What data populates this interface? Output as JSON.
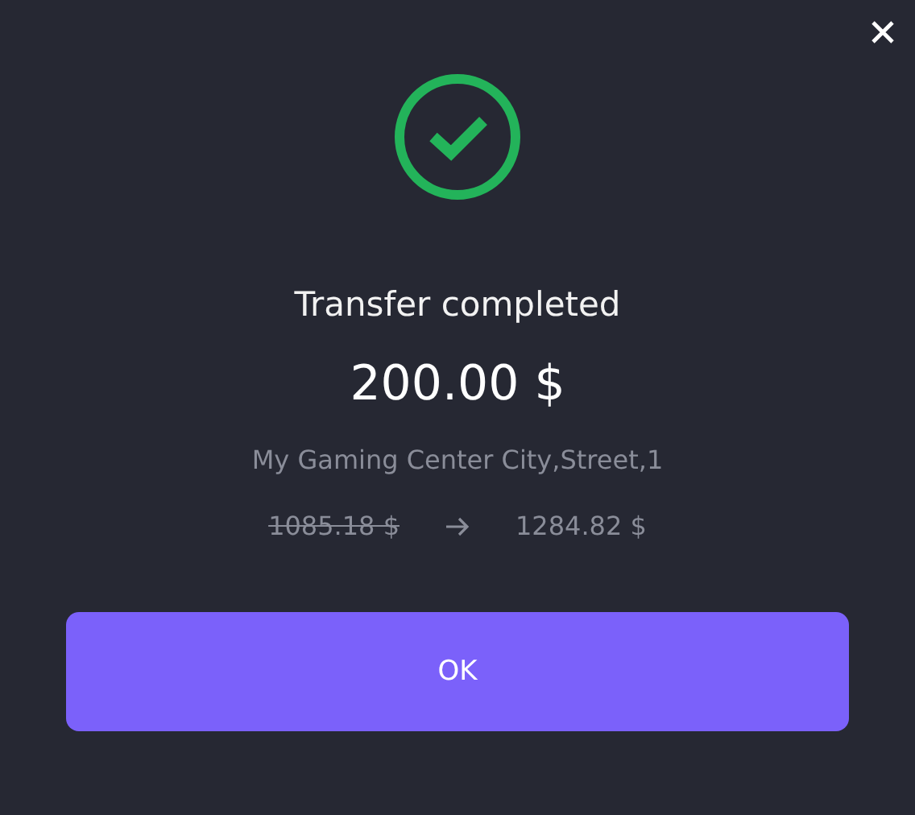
{
  "title": "Transfer completed",
  "amount": "200.00 $",
  "recipient": "My Gaming Center City,Street,1",
  "balance": {
    "before": "1085.18 $",
    "after": "1284.82 $"
  },
  "buttons": [
    "OK"
  ]
}
